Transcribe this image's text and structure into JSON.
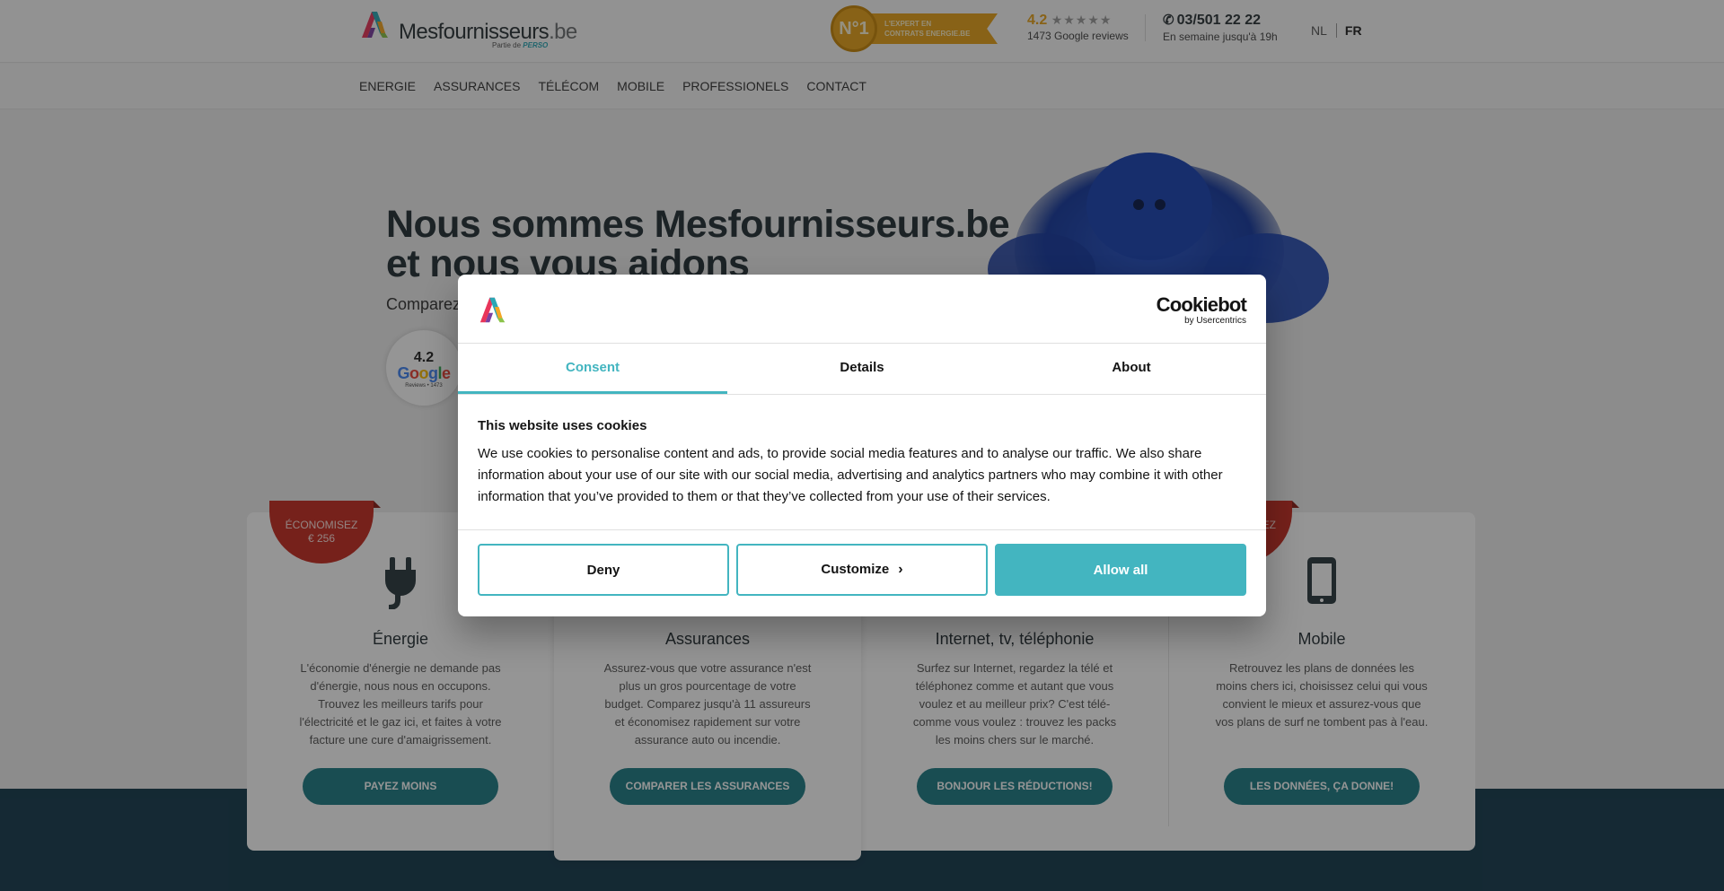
{
  "header": {
    "logo_text": "Mesfournisseurs",
    "logo_tld": ".be",
    "logo_partof": "Partie de",
    "logo_partof_brand": "PERSO",
    "award_medal": "N°1",
    "award_text_line1": "L'EXPERT EN",
    "award_text_line2": "CONTRATS ENERGIE.BE",
    "rating": "4.2",
    "stars": "★★★★★",
    "reviews": "1473 Google reviews",
    "phone": "03/501 22 22",
    "phone_hours": "En semaine jusqu'à 19h",
    "lang_nl": "NL",
    "lang_fr": "FR"
  },
  "nav": {
    "items": [
      "ENERGIE",
      "ASSURANCES",
      "TÉLÉCOM",
      "MOBILE",
      "PROFESSIONELS",
      "CONTACT"
    ]
  },
  "hero": {
    "title_line1": "Nous sommes Mesfournisseurs.be",
    "title_line2": "et nous vous aidons",
    "subtitle": "Comparez",
    "google_score": "4.2",
    "google_reviews_caption": "Reviews • 1473"
  },
  "cards": [
    {
      "title": "Énergie",
      "text": "L'économie d'énergie ne demande pas d'énergie, nous nous en occupons. Trouvez les meilleurs tarifs pour l'électricité et le gaz ici, et faites à votre facture une cure d'amaigrissement.",
      "cta": "PAYEZ MOINS",
      "savings_label": "ÉCONOMISEZ",
      "savings_value": "€ 256"
    },
    {
      "title": "Assurances",
      "text": "Assurez-vous que votre assurance n'est plus un gros pourcentage de votre budget. Comparez jusqu'à 11 assureurs et économisez rapidement sur votre assurance auto ou incendie.",
      "cta": "COMPARER LES ASSURANCES"
    },
    {
      "title": "Internet, tv, téléphonie",
      "text": "Surfez sur Internet, regardez la télé et téléphonez comme et autant que vous voulez et au meilleur prix? C'est télé-comme vous voulez : trouvez les packs les moins chers sur le marché.",
      "cta": "BONJOUR LES RÉDUCTIONS!"
    },
    {
      "title": "Mobile",
      "text": "Retrouvez les plans de données les moins chers ici, choisissez celui qui vous convient le mieux et assurez-vous que vos plans de surf ne tombent pas à l'eau.",
      "cta": "LES DONNÉES, ÇA DONNE!",
      "savings_label": "EZ"
    }
  ],
  "cookie_dialog": {
    "brand_name": "Cookiebot",
    "brand_by": "by Usercentrics",
    "tabs": [
      "Consent",
      "Details",
      "About"
    ],
    "heading": "This website uses cookies",
    "body": "We use cookies to personalise content and ads, to provide social media features and to analyse our traffic. We also share information about your use of our site with our social media, advertising and analytics partners who may combine it with other information that you’ve provided to them or that they’ve collected from your use of their services.",
    "deny": "Deny",
    "customize": "Customize",
    "allow_all": "Allow all"
  },
  "colors": {
    "accent": "#43b5c0",
    "cta_teal": "#1e7c85",
    "savings_red": "#c62d22",
    "footer_navy": "#153b4e",
    "gold": "#e7a21a"
  },
  "icons": {
    "phone": "phone-icon",
    "plug": "plug-icon",
    "mobile": "smartphone-icon",
    "chevron": "chevron-right-icon",
    "logo": "a-logo-icon"
  }
}
